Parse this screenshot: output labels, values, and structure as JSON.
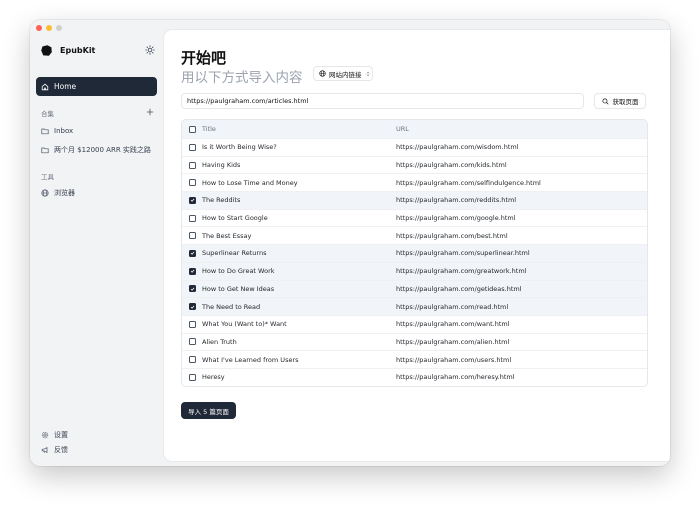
{
  "app": {
    "name": "EpubKit"
  },
  "sidebar": {
    "home_label": "Home",
    "collections_heading": "合集",
    "collections": [
      {
        "label": "Inbox"
      },
      {
        "label": "两个月 $12000 ARR 实践之路"
      }
    ],
    "tools_heading": "工具",
    "tools": [
      {
        "label": "浏览器"
      }
    ],
    "footer": [
      {
        "label": "设置"
      },
      {
        "label": "反馈"
      }
    ]
  },
  "main": {
    "title": "开始吧",
    "subtitle": "用以下方式导入内容",
    "mode_select": {
      "selected": "网站内链接"
    },
    "url_input": {
      "value": "https://paulgraham.com/articles.html"
    },
    "fetch_label": "获取页面",
    "table": {
      "headers": {
        "title": "Title",
        "url": "URL"
      },
      "rows": [
        {
          "title": "Is it Worth Being Wise?",
          "url": "https://paulgraham.com/wisdom.html",
          "checked": false
        },
        {
          "title": "Having Kids",
          "url": "https://paulgraham.com/kids.html",
          "checked": false
        },
        {
          "title": "How to Lose Time and Money",
          "url": "https://paulgraham.com/selfindulgence.html",
          "checked": false
        },
        {
          "title": "The Reddits",
          "url": "https://paulgraham.com/reddits.html",
          "checked": true
        },
        {
          "title": "How to Start Google",
          "url": "https://paulgraham.com/google.html",
          "checked": false
        },
        {
          "title": "The Best Essay",
          "url": "https://paulgraham.com/best.html",
          "checked": false
        },
        {
          "title": "Superlinear Returns",
          "url": "https://paulgraham.com/superlinear.html",
          "checked": true
        },
        {
          "title": "How to Do Great Work",
          "url": "https://paulgraham.com/greatwork.html",
          "checked": true
        },
        {
          "title": "How to Get New Ideas",
          "url": "https://paulgraham.com/getideas.html",
          "checked": true
        },
        {
          "title": "The Need to Read",
          "url": "https://paulgraham.com/read.html",
          "checked": true
        },
        {
          "title": "What You (Want to)* Want",
          "url": "https://paulgraham.com/want.html",
          "checked": false
        },
        {
          "title": "Alien Truth",
          "url": "https://paulgraham.com/alien.html",
          "checked": false
        },
        {
          "title": "What I've Learned from Users",
          "url": "https://paulgraham.com/users.html",
          "checked": false
        },
        {
          "title": "Heresy",
          "url": "https://paulgraham.com/heresy.html",
          "checked": false
        }
      ]
    },
    "import_label": "导入 5 篇页面"
  },
  "colors": {
    "accent": "#1f2937",
    "selected_row": "#f1f5f9",
    "subtitle": "#9ca3af"
  }
}
